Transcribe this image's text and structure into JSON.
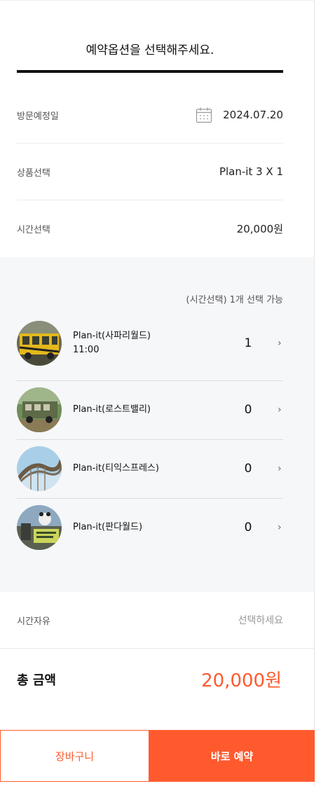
{
  "header": {
    "title": "예약옵션을 선택해주세요."
  },
  "visit_date": {
    "label": "방문예정일",
    "value": "2024.07.20",
    "icon": "calendar-icon"
  },
  "product": {
    "label": "상품선택",
    "value": "Plan-it 3 X 1"
  },
  "time": {
    "label": "시간선택",
    "value": "20,000원"
  },
  "options": {
    "note": "(시간선택) 1개 선택 가능",
    "items": [
      {
        "name": "Plan-it(사파리월드)",
        "time": "11:00",
        "qty": "1"
      },
      {
        "name": "Plan-it(로스트밸리)",
        "time": "",
        "qty": "0"
      },
      {
        "name": "Plan-it(티익스프레스)",
        "time": "",
        "qty": "0"
      },
      {
        "name": "Plan-it(판다월드)",
        "time": "",
        "qty": "0"
      }
    ]
  },
  "free_time": {
    "label": "시간자유",
    "placeholder": "선택하세요"
  },
  "total": {
    "label": "총 금액",
    "value": "20,000원"
  },
  "actions": {
    "cart_label": "장바구니",
    "book_label": "바로 예약"
  },
  "colors": {
    "accent": "#ff5a2e",
    "gray_bg": "#f6f7f9"
  }
}
